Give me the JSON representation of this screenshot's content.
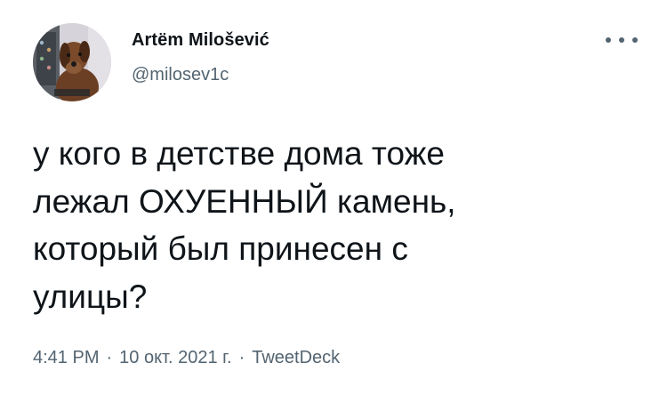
{
  "author": {
    "display_name": "Artëm Milošević",
    "handle": "@milosev1c",
    "avatar_icon": "dog-avatar-icon"
  },
  "tweet": {
    "text": "у кого в детстве дома тоже\nлежал ОХУЕННЫЙ камень,\nкоторый был принесен с\nулицы?"
  },
  "meta": {
    "time": "4:41 PM",
    "date": "10 окт. 2021 г.",
    "separator": "·",
    "source": "TweetDeck"
  },
  "menu": {
    "icon": "more-options-icon"
  },
  "colors": {
    "text": "#0f1419",
    "secondary": "#536471",
    "background": "#ffffff"
  }
}
